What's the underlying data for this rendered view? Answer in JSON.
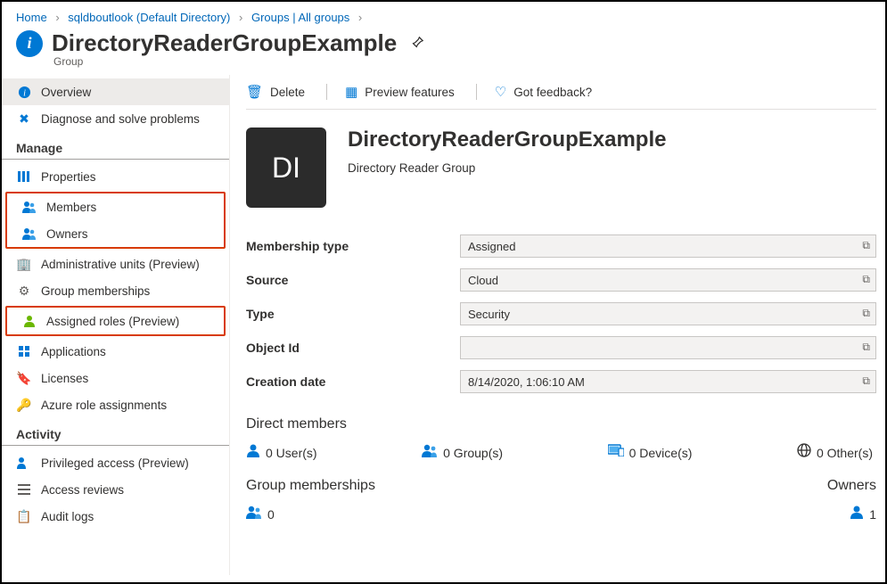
{
  "breadcrumb": {
    "home": "Home",
    "tenant": "sqldboutlook (Default Directory)",
    "groups": "Groups | All groups"
  },
  "header": {
    "title": "DirectoryReaderGroupExample",
    "subtitle": "Group"
  },
  "sidebar": {
    "overview": "Overview",
    "diagnose": "Diagnose and solve problems",
    "manage_header": "Manage",
    "properties": "Properties",
    "members": "Members",
    "owners": "Owners",
    "admin_units": "Administrative units (Preview)",
    "group_memberships": "Group memberships",
    "assigned_roles": "Assigned roles (Preview)",
    "applications": "Applications",
    "licenses": "Licenses",
    "azure_role": "Azure role assignments",
    "activity_header": "Activity",
    "privileged_access": "Privileged access (Preview)",
    "access_reviews": "Access reviews",
    "audit_logs": "Audit logs"
  },
  "toolbar": {
    "delete": "Delete",
    "preview_features": "Preview features",
    "feedback": "Got feedback?"
  },
  "hero": {
    "initials": "DI",
    "title": "DirectoryReaderGroupExample",
    "subtitle": "Directory Reader Group"
  },
  "props": {
    "membership_type_label": "Membership type",
    "membership_type_value": "Assigned",
    "source_label": "Source",
    "source_value": "Cloud",
    "type_label": "Type",
    "type_value": "Security",
    "object_id_label": "Object Id",
    "object_id_value": "",
    "creation_date_label": "Creation date",
    "creation_date_value": "8/14/2020, 1:06:10 AM"
  },
  "footer": {
    "direct_members_title": "Direct members",
    "users": "0 User(s)",
    "groups": "0 Group(s)",
    "devices": "0 Device(s)",
    "others": "0 Other(s)",
    "group_memberships_title": "Group memberships",
    "gm_count": "0",
    "owners_title": "Owners",
    "owners_count": "1"
  }
}
